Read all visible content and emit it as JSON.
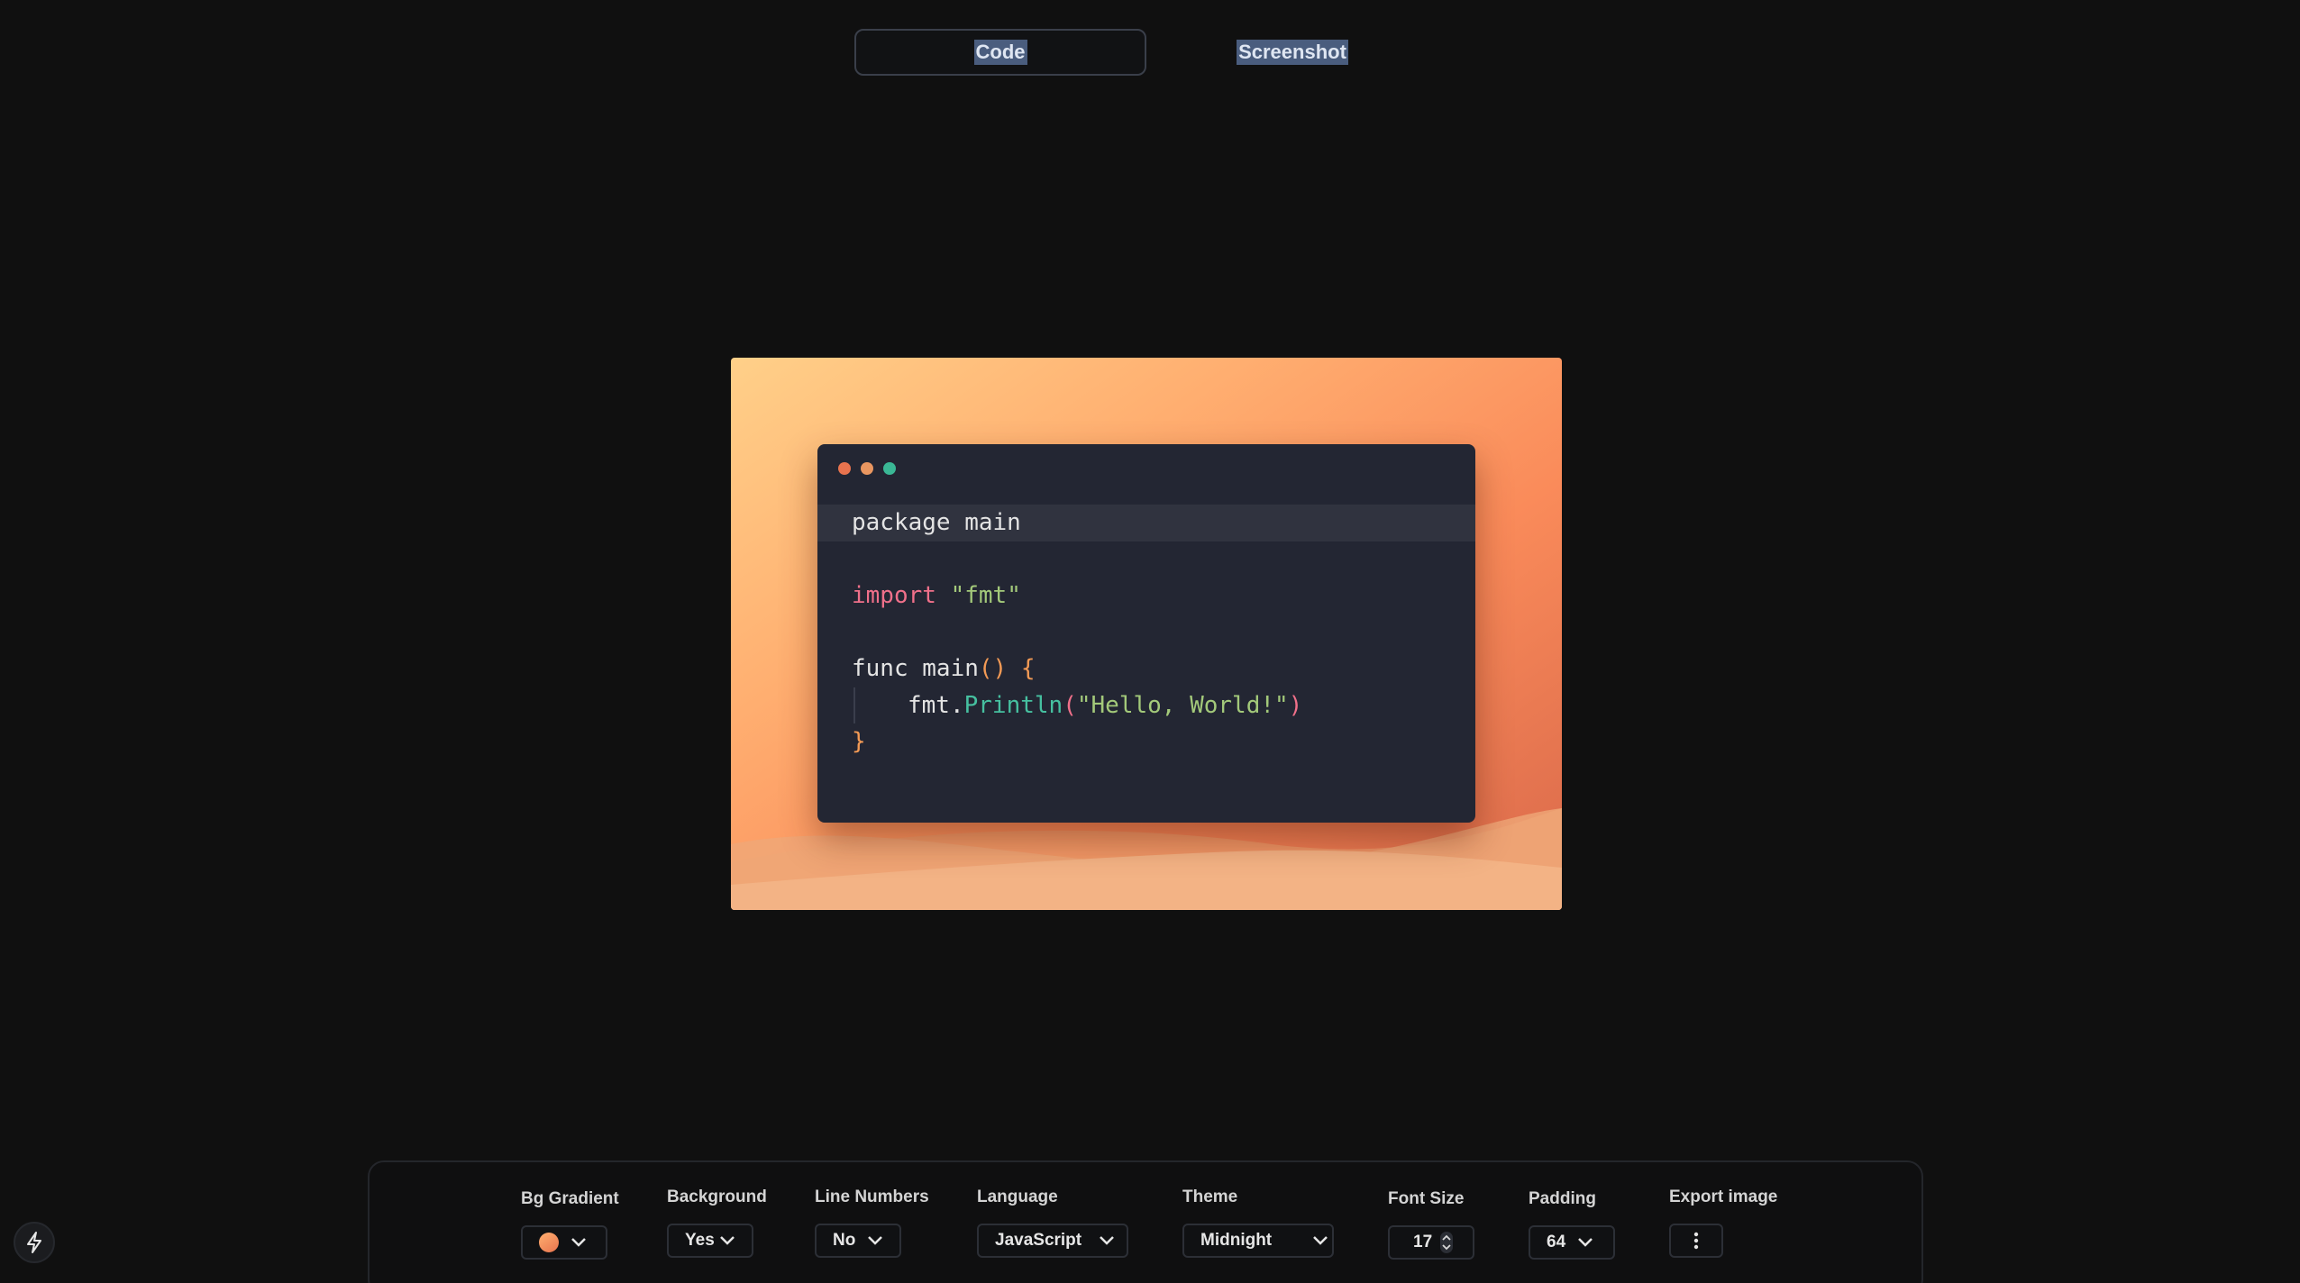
{
  "tabs": [
    {
      "label": "Code",
      "active": true
    },
    {
      "label": "Screenshot",
      "active": false
    }
  ],
  "window": {
    "dot_colors": [
      "#e8734e",
      "#e99660",
      "#3ab795"
    ]
  },
  "code": {
    "line1": {
      "text": "package main"
    },
    "line3": {
      "kw": "import",
      "space": " ",
      "str": "\"fmt\""
    },
    "line5": {
      "a": "func main",
      "b": "() {"
    },
    "line6": {
      "obj": "fmt.",
      "fn": "Println",
      "open": "(",
      "str": "\"Hello, World!\"",
      "close": ")"
    },
    "line7": {
      "brace": "}"
    }
  },
  "toolbar": {
    "bg_gradient": {
      "label": "Bg Gradient",
      "color": "#f08a5d"
    },
    "background": {
      "label": "Background",
      "value": "Yes"
    },
    "line_numbers": {
      "label": "Line Numbers",
      "value": "No"
    },
    "language": {
      "label": "Language",
      "value": "JavaScript"
    },
    "theme": {
      "label": "Theme",
      "value": "Midnight"
    },
    "font_size": {
      "label": "Font Size",
      "value": "17"
    },
    "padding": {
      "label": "Padding",
      "value": "64"
    },
    "export": {
      "label": "Export image",
      "icon": "more-vertical-icon"
    }
  },
  "side": {
    "icon": "lightning-icon"
  }
}
